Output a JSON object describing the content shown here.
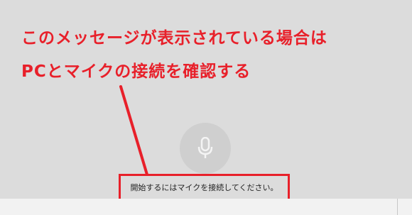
{
  "annotation": {
    "line1": "このメッセージが表示されている場合は",
    "line2": "PCとマイクの接続を確認する"
  },
  "status": {
    "message": "開始するにはマイクを接続してください。"
  },
  "mic": {
    "icon": "microphone-icon"
  },
  "colors": {
    "annotation_red": "#e8202a",
    "panel_bg": "#dcdcdc",
    "bottom_bar_bg": "#f2f2f2",
    "mic_button_bg": "#cfcfcf",
    "mic_icon": "#f4f4f4"
  }
}
